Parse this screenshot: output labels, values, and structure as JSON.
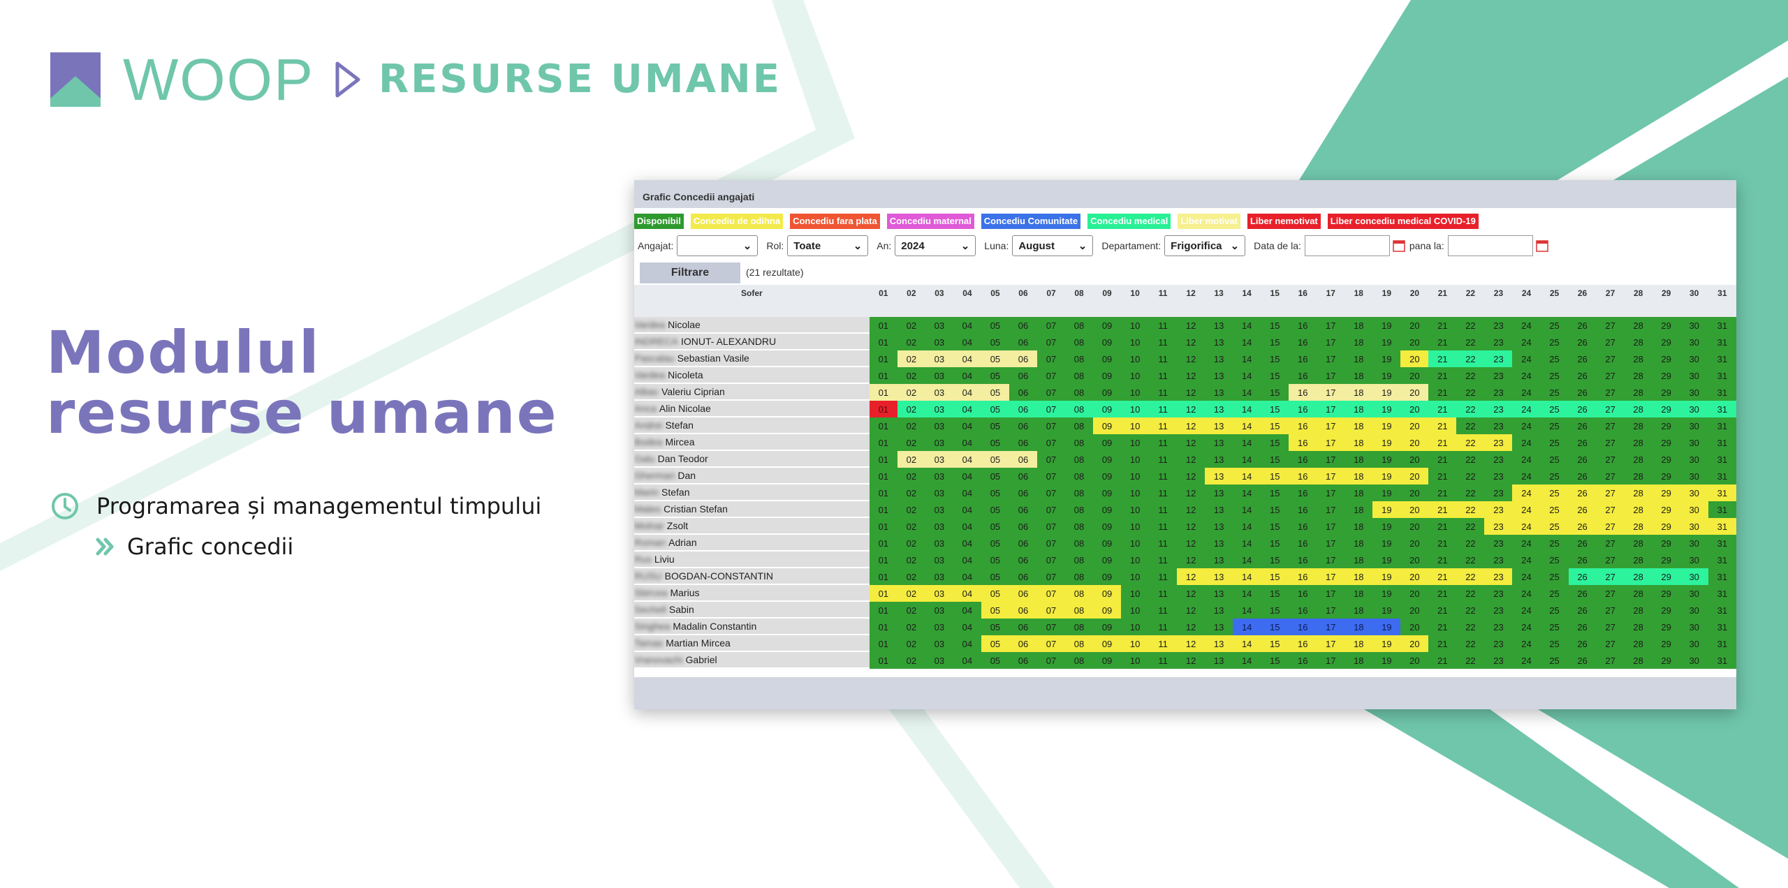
{
  "brand": {
    "name": "WOOP",
    "section": "RESURSE UMANE",
    "accent": "#6fc6ab",
    "primary": "#7a75bb"
  },
  "headline": "Modulul resurse umane",
  "bullets": {
    "item1": "Programarea și managementul timpului",
    "item2": "Grafic concedii"
  },
  "screen": {
    "title": "Grafic Concedii angajati",
    "legend": [
      {
        "label": "Disponibil",
        "color": "#2e9a2e"
      },
      {
        "label": "Concediu de odihna",
        "color": "#f2ea4b"
      },
      {
        "label": "Concediu fara plata",
        "color": "#ef5533"
      },
      {
        "label": "Concediu maternal",
        "color": "#e05ad8"
      },
      {
        "label": "Concediu Comunitate",
        "color": "#3c72e8"
      },
      {
        "label": "Concediu medical",
        "color": "#28f095"
      },
      {
        "label": "Liber motivat",
        "color": "#f6f08f"
      },
      {
        "label": "Liber nemotivat",
        "color": "#e8202a"
      },
      {
        "label": "Liber concediu medical COVID-19",
        "color": "#e8202a"
      }
    ],
    "filters": {
      "angajat_label": "Angajat:",
      "angajat_value": "",
      "rol_label": "Rol:",
      "rol_value": "Toate",
      "an_label": "An:",
      "an_value": "2024",
      "luna_label": "Luna:",
      "luna_value": "August",
      "dep_label": "Departament:",
      "dep_value": "Frigorifica",
      "data_de_la_label": "Data de la:",
      "pana_la_label": "pana la:"
    },
    "filter_button": "Filtrare",
    "results": "(21 rezultate)",
    "column_header": "Sofer",
    "days": [
      "01",
      "02",
      "03",
      "04",
      "05",
      "06",
      "07",
      "08",
      "09",
      "10",
      "11",
      "12",
      "13",
      "14",
      "15",
      "16",
      "17",
      "18",
      "19",
      "20",
      "21",
      "22",
      "23",
      "24",
      "25",
      "26",
      "27",
      "28",
      "29",
      "30",
      "31"
    ],
    "colors": {
      "D": "#33a033",
      "O": "#f4ec3e",
      "M": "#2df39d",
      "R": "#e8202a",
      "C": "#3d6cf0",
      "L": "#f3eea0"
    },
    "rows": [
      {
        "surname": "Vardea",
        "given": "Nicolae",
        "codes": "DDDDDDDDDDDDDDDDDDDDDDDDDDDDDDD"
      },
      {
        "surname": "INDRECA",
        "given": "IONUT- ALEXANDRU",
        "codes": "DDDDDDDDDDDDDDDDDDDDDDDDDDDDDDD"
      },
      {
        "surname": "Pascalau",
        "given": "Sebastian Vasile",
        "codes": "DLLLLLDDDDDDDDDDDDDOMMMDDDDDDDD"
      },
      {
        "surname": "Vardea",
        "given": "Nicoleta",
        "codes": "DDDDDDDDDDDDDDDDDDDDDDDDDDDDDDD"
      },
      {
        "surname": "Albac",
        "given": "Valeriu Ciprian",
        "codes": "LLLLLDDDDDDDDDDLLLLLDDDDDDDDDDD"
      },
      {
        "surname": "Anca",
        "given": "Alin Nicolae",
        "codes": "RMMMMMMMMMMMMMMMMMMMMMMMMMMMMMM"
      },
      {
        "surname": "Andrei",
        "given": "Stefan",
        "codes": "DDDDDDDDOOOOOOOOOOOOODDDDDDDDDD"
      },
      {
        "surname": "Bodea",
        "given": "Mircea",
        "codes": "DDDDDDDDDDDDDDDOOOOOOOODDDDDDDD"
      },
      {
        "surname": "Galu",
        "given": "Dan Teodor",
        "codes": "DLLLLLDDDDDDDDDDDDDDDDDDDDDDDDD"
      },
      {
        "surname": "Gherman",
        "given": "Dan",
        "codes": "DDDDDDDDDDDDOOOOOOOODDDDDDDDDDD"
      },
      {
        "surname": "Marin",
        "given": "Stefan",
        "codes": "DDDDDDDDDDDDDDDDDDDDDDDOOOOOOOO"
      },
      {
        "surname": "Mates",
        "given": "Cristian Stefan",
        "codes": "DDDDDDDDDDDDDDDDDDOOOOOOOOOOOOD"
      },
      {
        "surname": "Molnar",
        "given": "Zsolt",
        "codes": "DDDDDDDDDDDDDDDDDDDDDDOOOOOOOOO"
      },
      {
        "surname": "Roman",
        "given": "Adrian",
        "codes": "DDDDDDDDDDDDDDDDDDDDDDDDDDDDDDD"
      },
      {
        "surname": "Rus",
        "given": "Liviu",
        "codes": "DDDDDDDDDDDDDDDDDDDDDDDDDDDDDDD"
      },
      {
        "surname": "RUSU",
        "given": "BOGDAN-CONSTANTIN",
        "codes": "DDDDDDDDDDDOOOOOOOOOOOODDMMMMMD"
      },
      {
        "surname": "Sbircea",
        "given": "Marius",
        "codes": "OOOOOOOOODDDDDDDDDDDDDDDDDDDDDD"
      },
      {
        "surname": "Sechell",
        "given": "Sabin",
        "codes": "DDDDOOOOODDDDDDDDDDDDDDDDDDDDDD"
      },
      {
        "surname": "Singhea",
        "given": "Madalin Constantin",
        "codes": "DDDDDDDDDDDDDCCCCCCDDDDDDDDDDDD"
      },
      {
        "surname": "Tamas",
        "given": "Martian Mircea",
        "codes": "DDDDOOOOOOOOOOOOOOOODDDDDDDDDDD"
      },
      {
        "surname": "Vranovachi",
        "given": "Gabriel",
        "codes": "DDDDDDDDDDDDDDDDDDDDDDDDDDDDDDD"
      }
    ]
  }
}
